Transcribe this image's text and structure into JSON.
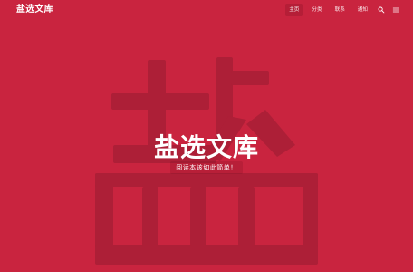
{
  "colors": {
    "background": "#c9243f",
    "watermark": "#ad1f37",
    "text": "#ffffff"
  },
  "header": {
    "site_title": "盐选文库",
    "nav": [
      {
        "label": "主页",
        "active": true
      },
      {
        "label": "分类",
        "active": false
      },
      {
        "label": "联系",
        "active": false
      },
      {
        "label": "通知",
        "active": false
      }
    ],
    "icons": [
      "search-icon",
      "menu-icon"
    ]
  },
  "hero": {
    "watermark_character": "盐",
    "title": "盐选文库",
    "subtitle": "阅读本该如此简单！"
  }
}
